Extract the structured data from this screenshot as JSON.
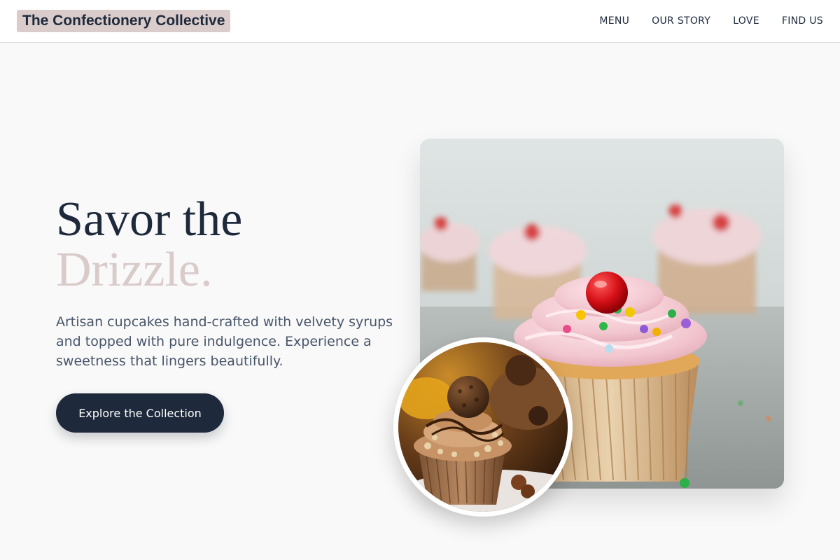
{
  "header": {
    "logo": "The Confectionery Collective",
    "nav": [
      "MENU",
      "OUR STORY",
      "LOVE",
      "FIND US"
    ]
  },
  "hero": {
    "title_line1": "Savor the",
    "title_line2": "Drizzle.",
    "description": "Artisan cupcakes hand-crafted with velvety syrups and topped with pure indulgence. Experience a sweetness that lingers beautifully.",
    "cta_label": "Explore the Collection"
  },
  "images": {
    "main": "pink-frosted-cupcake-with-cherry-photo",
    "inset": "chocolate-hazelnut-cupcake-photo"
  },
  "colors": {
    "primary": "#1e293b",
    "accent": "#d8cbc9",
    "background": "#f9f9f9"
  }
}
